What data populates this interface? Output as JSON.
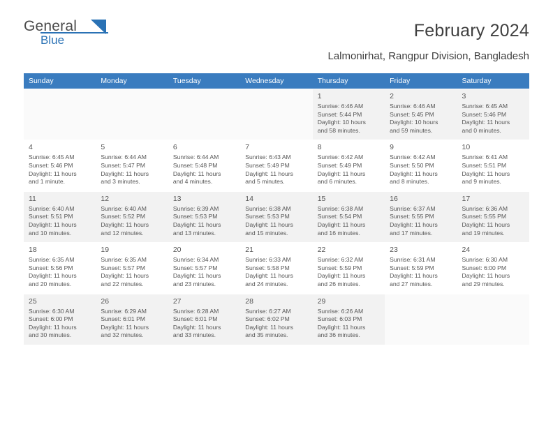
{
  "brand": {
    "name_line1": "General",
    "name_line2": "Blue",
    "logo_icon": "triangle-flag-icon"
  },
  "header": {
    "title": "February 2024",
    "subtitle": "Lalmonirhat, Rangpur Division, Bangladesh"
  },
  "colors": {
    "header_blue": "#3a7cbf",
    "brand_blue": "#2a72b5",
    "band_gray": "#f2f2f2",
    "text": "#555555"
  },
  "calendar": {
    "weekdays": [
      "Sunday",
      "Monday",
      "Tuesday",
      "Wednesday",
      "Thursday",
      "Friday",
      "Saturday"
    ],
    "weeks": [
      [
        {
          "day": "",
          "lines": []
        },
        {
          "day": "",
          "lines": []
        },
        {
          "day": "",
          "lines": []
        },
        {
          "day": "",
          "lines": []
        },
        {
          "day": "1",
          "lines": [
            "Sunrise: 6:46 AM",
            "Sunset: 5:44 PM",
            "Daylight: 10 hours",
            "and 58 minutes."
          ]
        },
        {
          "day": "2",
          "lines": [
            "Sunrise: 6:46 AM",
            "Sunset: 5:45 PM",
            "Daylight: 10 hours",
            "and 59 minutes."
          ]
        },
        {
          "day": "3",
          "lines": [
            "Sunrise: 6:45 AM",
            "Sunset: 5:46 PM",
            "Daylight: 11 hours",
            "and 0 minutes."
          ]
        }
      ],
      [
        {
          "day": "4",
          "lines": [
            "Sunrise: 6:45 AM",
            "Sunset: 5:46 PM",
            "Daylight: 11 hours",
            "and 1 minute."
          ]
        },
        {
          "day": "5",
          "lines": [
            "Sunrise: 6:44 AM",
            "Sunset: 5:47 PM",
            "Daylight: 11 hours",
            "and 3 minutes."
          ]
        },
        {
          "day": "6",
          "lines": [
            "Sunrise: 6:44 AM",
            "Sunset: 5:48 PM",
            "Daylight: 11 hours",
            "and 4 minutes."
          ]
        },
        {
          "day": "7",
          "lines": [
            "Sunrise: 6:43 AM",
            "Sunset: 5:49 PM",
            "Daylight: 11 hours",
            "and 5 minutes."
          ]
        },
        {
          "day": "8",
          "lines": [
            "Sunrise: 6:42 AM",
            "Sunset: 5:49 PM",
            "Daylight: 11 hours",
            "and 6 minutes."
          ]
        },
        {
          "day": "9",
          "lines": [
            "Sunrise: 6:42 AM",
            "Sunset: 5:50 PM",
            "Daylight: 11 hours",
            "and 8 minutes."
          ]
        },
        {
          "day": "10",
          "lines": [
            "Sunrise: 6:41 AM",
            "Sunset: 5:51 PM",
            "Daylight: 11 hours",
            "and 9 minutes."
          ]
        }
      ],
      [
        {
          "day": "11",
          "lines": [
            "Sunrise: 6:40 AM",
            "Sunset: 5:51 PM",
            "Daylight: 11 hours",
            "and 10 minutes."
          ]
        },
        {
          "day": "12",
          "lines": [
            "Sunrise: 6:40 AM",
            "Sunset: 5:52 PM",
            "Daylight: 11 hours",
            "and 12 minutes."
          ]
        },
        {
          "day": "13",
          "lines": [
            "Sunrise: 6:39 AM",
            "Sunset: 5:53 PM",
            "Daylight: 11 hours",
            "and 13 minutes."
          ]
        },
        {
          "day": "14",
          "lines": [
            "Sunrise: 6:38 AM",
            "Sunset: 5:53 PM",
            "Daylight: 11 hours",
            "and 15 minutes."
          ]
        },
        {
          "day": "15",
          "lines": [
            "Sunrise: 6:38 AM",
            "Sunset: 5:54 PM",
            "Daylight: 11 hours",
            "and 16 minutes."
          ]
        },
        {
          "day": "16",
          "lines": [
            "Sunrise: 6:37 AM",
            "Sunset: 5:55 PM",
            "Daylight: 11 hours",
            "and 17 minutes."
          ]
        },
        {
          "day": "17",
          "lines": [
            "Sunrise: 6:36 AM",
            "Sunset: 5:55 PM",
            "Daylight: 11 hours",
            "and 19 minutes."
          ]
        }
      ],
      [
        {
          "day": "18",
          "lines": [
            "Sunrise: 6:35 AM",
            "Sunset: 5:56 PM",
            "Daylight: 11 hours",
            "and 20 minutes."
          ]
        },
        {
          "day": "19",
          "lines": [
            "Sunrise: 6:35 AM",
            "Sunset: 5:57 PM",
            "Daylight: 11 hours",
            "and 22 minutes."
          ]
        },
        {
          "day": "20",
          "lines": [
            "Sunrise: 6:34 AM",
            "Sunset: 5:57 PM",
            "Daylight: 11 hours",
            "and 23 minutes."
          ]
        },
        {
          "day": "21",
          "lines": [
            "Sunrise: 6:33 AM",
            "Sunset: 5:58 PM",
            "Daylight: 11 hours",
            "and 24 minutes."
          ]
        },
        {
          "day": "22",
          "lines": [
            "Sunrise: 6:32 AM",
            "Sunset: 5:59 PM",
            "Daylight: 11 hours",
            "and 26 minutes."
          ]
        },
        {
          "day": "23",
          "lines": [
            "Sunrise: 6:31 AM",
            "Sunset: 5:59 PM",
            "Daylight: 11 hours",
            "and 27 minutes."
          ]
        },
        {
          "day": "24",
          "lines": [
            "Sunrise: 6:30 AM",
            "Sunset: 6:00 PM",
            "Daylight: 11 hours",
            "and 29 minutes."
          ]
        }
      ],
      [
        {
          "day": "25",
          "lines": [
            "Sunrise: 6:30 AM",
            "Sunset: 6:00 PM",
            "Daylight: 11 hours",
            "and 30 minutes."
          ]
        },
        {
          "day": "26",
          "lines": [
            "Sunrise: 6:29 AM",
            "Sunset: 6:01 PM",
            "Daylight: 11 hours",
            "and 32 minutes."
          ]
        },
        {
          "day": "27",
          "lines": [
            "Sunrise: 6:28 AM",
            "Sunset: 6:01 PM",
            "Daylight: 11 hours",
            "and 33 minutes."
          ]
        },
        {
          "day": "28",
          "lines": [
            "Sunrise: 6:27 AM",
            "Sunset: 6:02 PM",
            "Daylight: 11 hours",
            "and 35 minutes."
          ]
        },
        {
          "day": "29",
          "lines": [
            "Sunrise: 6:26 AM",
            "Sunset: 6:03 PM",
            "Daylight: 11 hours",
            "and 36 minutes."
          ]
        },
        {
          "day": "",
          "lines": []
        },
        {
          "day": "",
          "lines": []
        }
      ]
    ]
  }
}
